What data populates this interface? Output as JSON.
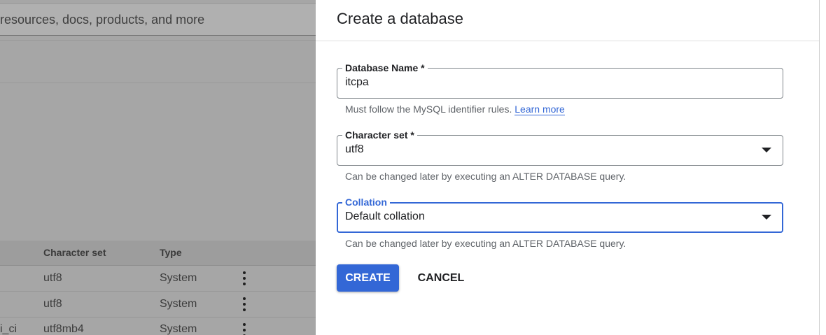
{
  "background": {
    "search_placeholder": "resources, docs, products, and more",
    "table": {
      "headers": [
        "Character set",
        "Type"
      ],
      "rows": [
        {
          "prefix": "",
          "character_set": "utf8",
          "type": "System"
        },
        {
          "prefix": "",
          "character_set": "utf8",
          "type": "System"
        },
        {
          "prefix": "i_ci",
          "character_set": "utf8mb4",
          "type": "System"
        }
      ],
      "row_menu_icon": "more-vert-icon"
    }
  },
  "panel": {
    "title": "Create a database",
    "fields": {
      "database_name": {
        "label": "Database Name *",
        "value": "itcpa",
        "helper": "Must follow the MySQL identifier rules.",
        "helper_link": "Learn more"
      },
      "character_set": {
        "label": "Character set *",
        "value": "utf8",
        "helper": "Can be changed later by executing an ALTER DATABASE query."
      },
      "collation": {
        "label": "Collation",
        "value": "Default collation",
        "helper": "Can be changed later by executing an ALTER DATABASE query."
      }
    },
    "actions": {
      "create_label": "CREATE",
      "cancel_label": "CANCEL"
    }
  },
  "colors": {
    "accent": "#3367d6",
    "scrim": "#a6a6a6",
    "text_primary": "#202124",
    "text_secondary": "#5f6368"
  }
}
